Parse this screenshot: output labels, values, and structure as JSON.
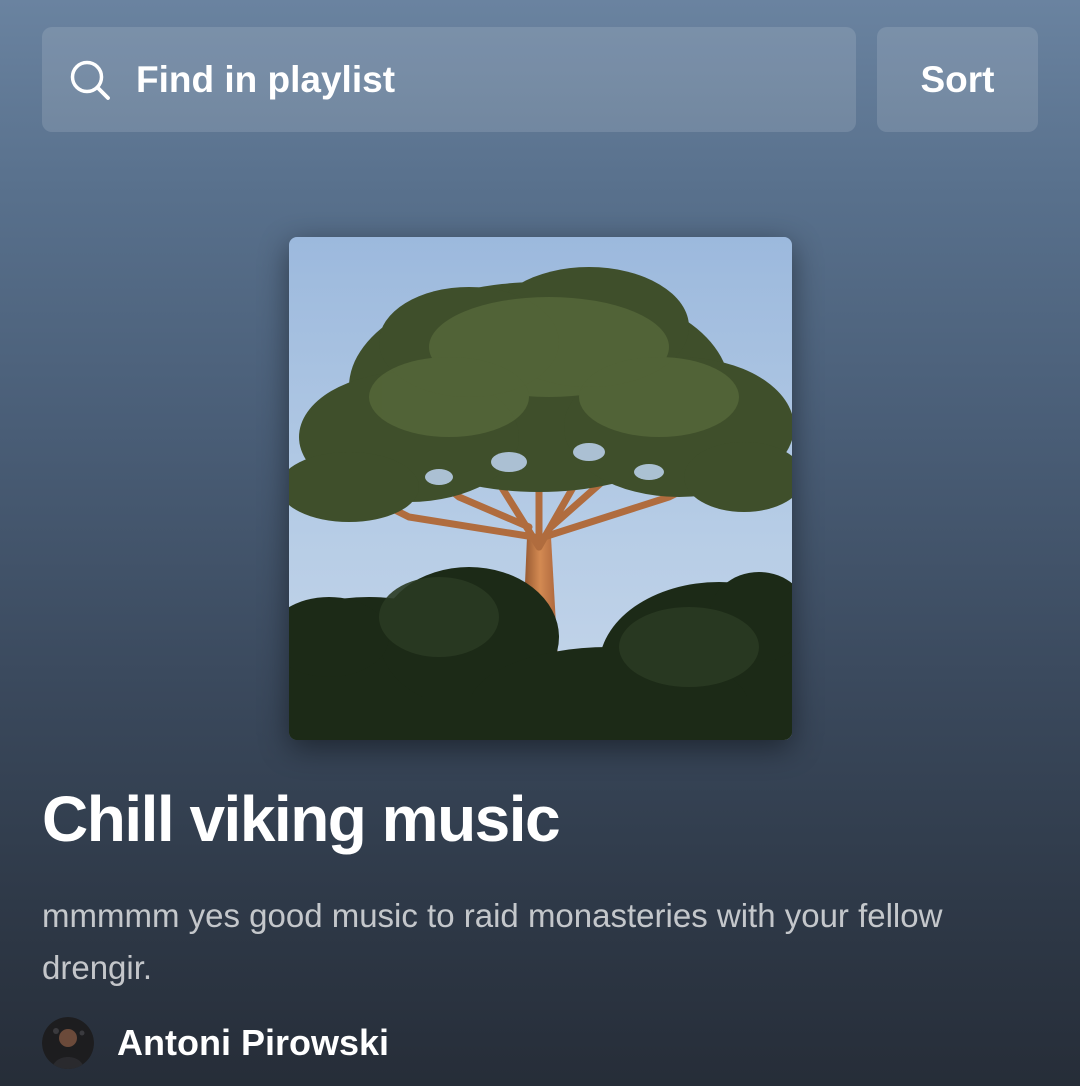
{
  "search": {
    "placeholder": "Find in playlist",
    "icon": "search-icon"
  },
  "sort": {
    "label": "Sort"
  },
  "playlist": {
    "cover_description": "playlist-cover-image",
    "title": "Chill viking music",
    "description": "mmmmm yes good music to raid monasteries with your fellow drengir.",
    "owner": {
      "name": "Antoni Pirowski",
      "avatar": "owner-avatar"
    }
  },
  "colors": {
    "background_top": "#6a83a0",
    "background_bottom": "#262d38",
    "control_fill": "rgba(255,255,255,0.13)",
    "text_primary": "#ffffff",
    "text_secondary": "rgba(255,255,255,0.72)"
  }
}
